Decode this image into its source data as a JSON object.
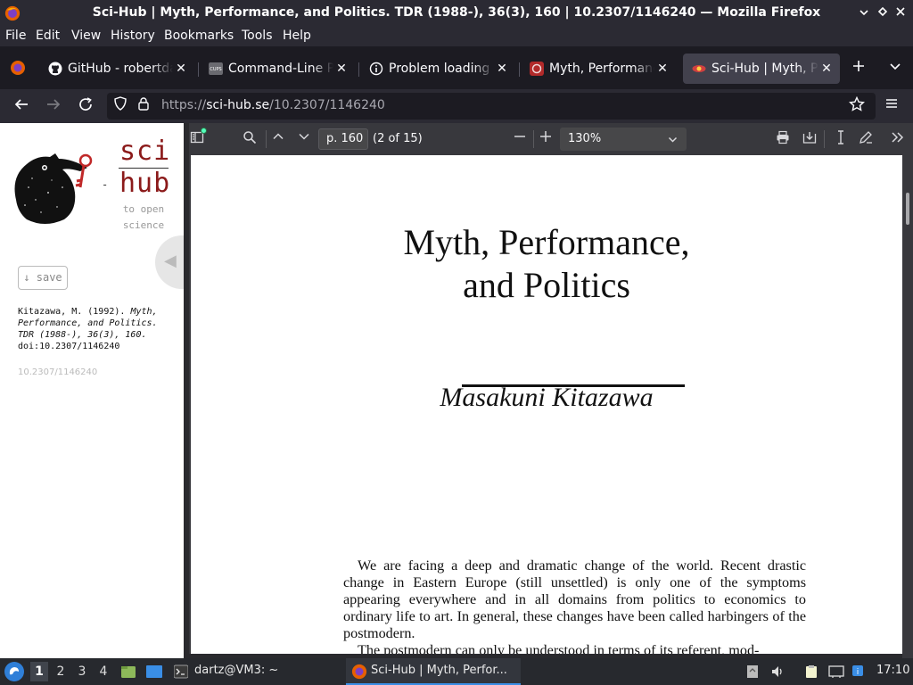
{
  "window": {
    "title": "Sci-Hub | Myth, Performance, and Politics. TDR (1988-), 36(3), 160 | 10.2307/1146240 — Mozilla Firefox"
  },
  "menubar": {
    "items": [
      {
        "label": "File"
      },
      {
        "label": "Edit"
      },
      {
        "label": "View"
      },
      {
        "label": "History"
      },
      {
        "label": "Bookmarks"
      },
      {
        "label": "Tools"
      },
      {
        "label": "Help"
      }
    ]
  },
  "tabs": [
    {
      "label": "GitHub - robertdav",
      "icon": "github-icon",
      "active": false
    },
    {
      "label": "Command-Line Pri",
      "icon": "cups-icon",
      "active": false
    },
    {
      "label": "Problem loading pa",
      "icon": "info-icon",
      "active": false
    },
    {
      "label": "Myth, Performance",
      "icon": "jstor-icon",
      "active": false
    },
    {
      "label": "Sci-Hub | Myth, Pe",
      "icon": "scihub-icon",
      "active": true
    }
  ],
  "navbar": {
    "url_prefix": "https://",
    "url_host": "sci-hub.se",
    "url_path": "/10.2307/1146240"
  },
  "scihub": {
    "logo_top": "sci",
    "logo_bottom": "hub",
    "logo_dash": "-",
    "tagline_1": "to open",
    "tagline_2": "science",
    "save_label": "↓ save",
    "citation_authors": "Kitazawa, M. (1992). ",
    "citation_title": "Myth, Performance, and Politics. TDR (1988-), 36(3), 160.",
    "citation_doi": "doi:10.2307/1146240",
    "doi_link": "10.2307/1146240"
  },
  "pdf": {
    "page_input": "p. 160",
    "page_count": "(2 of 15)",
    "zoom": "130%",
    "title_line1": "Myth, Performance,",
    "title_line2": "and Politics",
    "author": "Masakuni Kitazawa",
    "paragraph1": "We are facing a deep and dramatic change of the world. Recent drastic change in Eastern Europe (still unsettled) is only one of the symptoms appearing everywhere and in all domains from politics to economics to ordinary life to art. In general, these changes have been called harbingers of the postmodern.",
    "paragraph2": "The postmodern can only be understood in terms of its referent, mod-"
  },
  "taskbar": {
    "workspaces": [
      "1",
      "2",
      "3",
      "4"
    ],
    "terminal_label": "dartz@VM3: ~",
    "firefox_label": "Sci-Hub | Myth, Perfor...",
    "clock": "17:10"
  },
  "colors": {
    "scihub_red": "#8b1a1a",
    "pdf_toolbar": "#38383d",
    "taskbar": "#27292e"
  }
}
